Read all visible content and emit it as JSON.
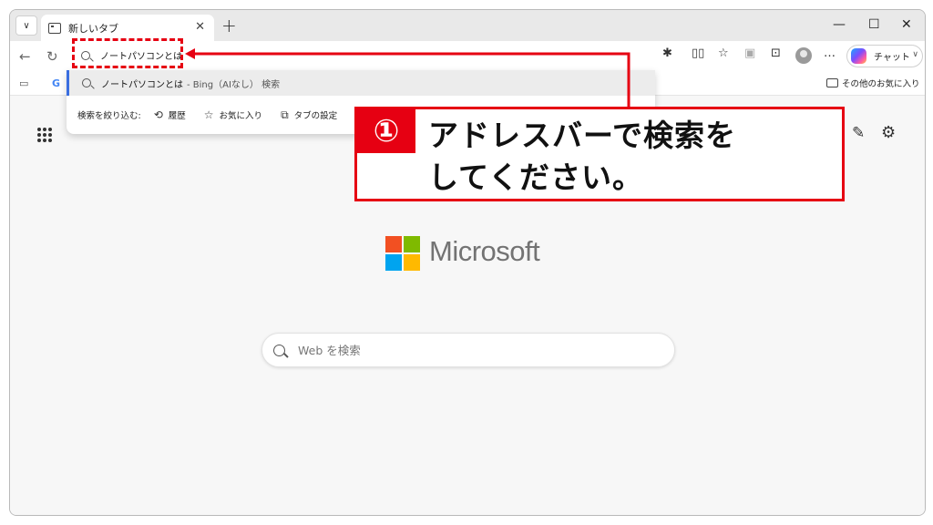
{
  "tab": {
    "title": "新しいタブ",
    "close": "✕",
    "new_tab": "+"
  },
  "window_controls": {
    "minimize": "—",
    "maximize": "☐",
    "close": "✕"
  },
  "toolbar": {
    "back": "←",
    "refresh": "↻",
    "chat_label": "チャット",
    "more": "…"
  },
  "address_bar": {
    "value": "ノートパソコンとは"
  },
  "dropdown": {
    "suggestion_main": "ノートパソコンとは",
    "suggestion_suffix": "- Bing（AIなし） 検索",
    "filter_label": "検索を絞り込む:",
    "filters": [
      "履歴",
      "お気に入り",
      "タブの設定"
    ]
  },
  "bookmarks": {
    "other_favorites": "その他のお気に入り"
  },
  "page": {
    "brand": "Microsoft",
    "search_placeholder": "Web を検索"
  },
  "annotation": {
    "step_number": "①",
    "line1": "アドレスバーで検索を",
    "line2": "してください。",
    "color": "#e60012"
  }
}
